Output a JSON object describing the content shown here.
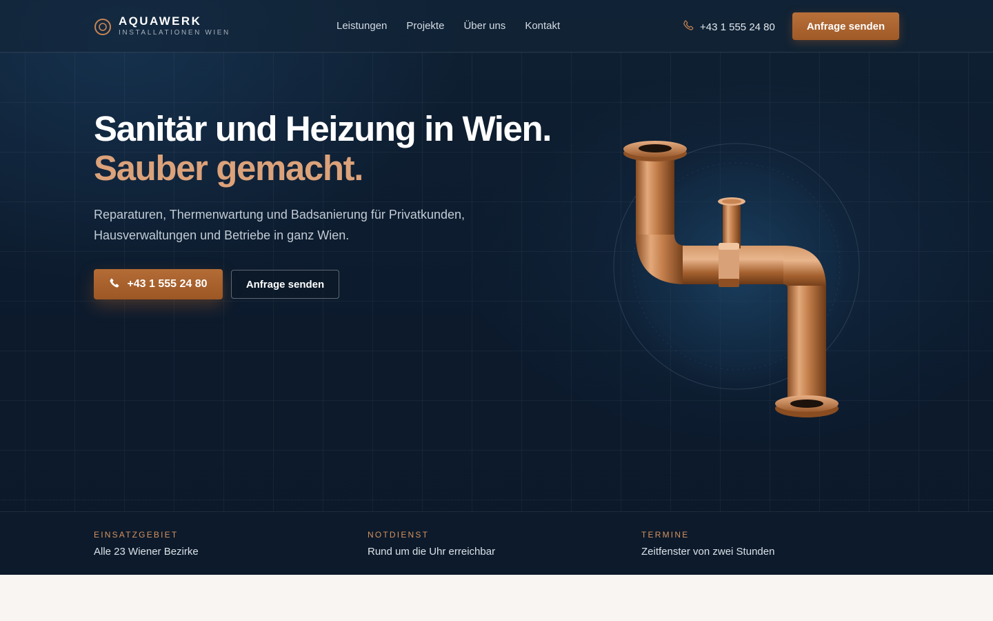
{
  "brand": {
    "name": "AQUAWERK",
    "subtitle": "INSTALLATIONEN WIEN"
  },
  "nav": {
    "items": [
      {
        "label": "Leistungen"
      },
      {
        "label": "Projekte"
      },
      {
        "label": "Über uns"
      },
      {
        "label": "Kontakt"
      }
    ]
  },
  "header": {
    "phone": "+43 1 555 24 80",
    "cta_label": "Anfrage senden",
    "phone_icon": "phone-icon"
  },
  "hero": {
    "title_line1": "Sanitär und Heizung in Wien.",
    "title_line2": "Sauber gemacht.",
    "lead": "Reparaturen, Thermenwartung und Badsanierung für Privatkunden, Hausverwaltungen und Betriebe in ganz Wien.",
    "phone_button": "+43 1 555 24 80",
    "request_button": "Anfrage senden"
  },
  "stats": [
    {
      "label": "EINSATZGEBIET",
      "value": "Alle 23 Wiener Bezirke"
    },
    {
      "label": "NOTDIENST",
      "value": "Rund um die Uhr erreichbar"
    },
    {
      "label": "TERMINE",
      "value": "Zeitfenster von zwei Stunden"
    }
  ],
  "colors": {
    "accent": "#a8612c",
    "accent_text": "#dca27a",
    "background": "#0c1a2c"
  }
}
